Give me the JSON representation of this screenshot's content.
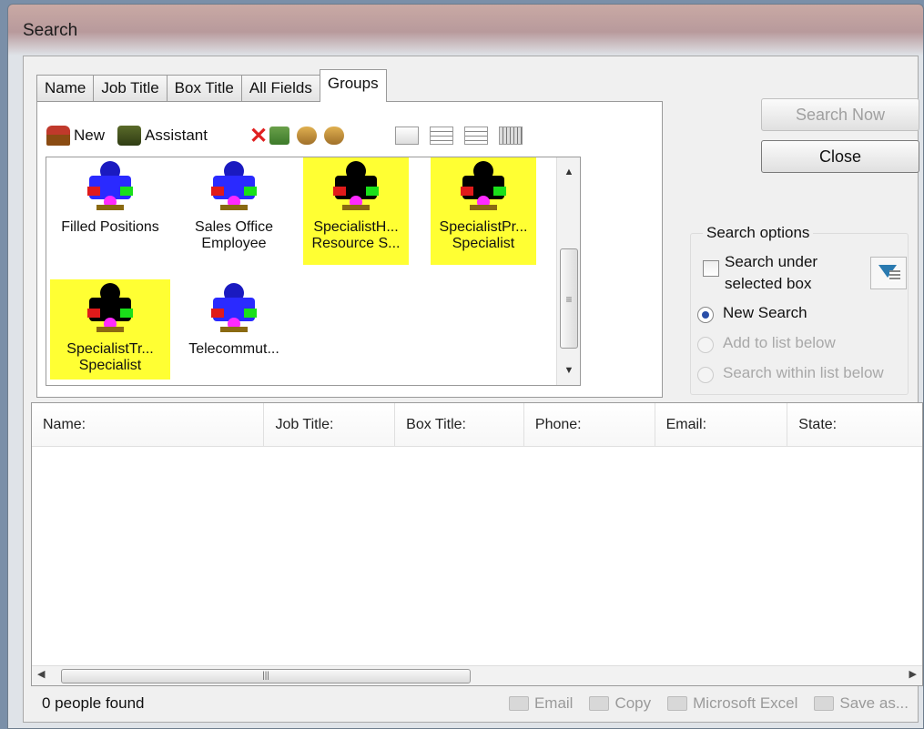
{
  "window": {
    "title": "Search"
  },
  "tabs": [
    {
      "label": "Name"
    },
    {
      "label": "Job Title"
    },
    {
      "label": "Box Title"
    },
    {
      "label": "All Fields"
    },
    {
      "label": "Groups"
    }
  ],
  "toolbar": {
    "new_label": "New",
    "assistant_label": "Assistant"
  },
  "groups": [
    {
      "line1": "Filled Positions",
      "line2": "",
      "selected": false
    },
    {
      "line1": "Sales Office",
      "line2": "Employee",
      "selected": false
    },
    {
      "line1": "SpecialistH...",
      "line2": "Resource S...",
      "selected": true
    },
    {
      "line1": "SpecialistPr...",
      "line2": "Specialist",
      "selected": true
    },
    {
      "line1": "SpecialistTr...",
      "line2": "Specialist",
      "selected": true
    },
    {
      "line1": "Telecommut...",
      "line2": "",
      "selected": false
    }
  ],
  "buttons": {
    "search_now": "Search Now",
    "close": "Close"
  },
  "options": {
    "legend": "Search options",
    "search_under": "Search under selected box",
    "new_search": "New Search",
    "add_to_list": "Add to list below",
    "search_within": "Search within list below"
  },
  "results": {
    "columns": [
      "Name:",
      "Job Title:",
      "Box Title:",
      "Phone:",
      "Email:",
      "State:"
    ],
    "count_text": "0 people found"
  },
  "actions": {
    "email": "Email",
    "copy": "Copy",
    "excel": "Microsoft Excel",
    "save_as": "Save as..."
  }
}
